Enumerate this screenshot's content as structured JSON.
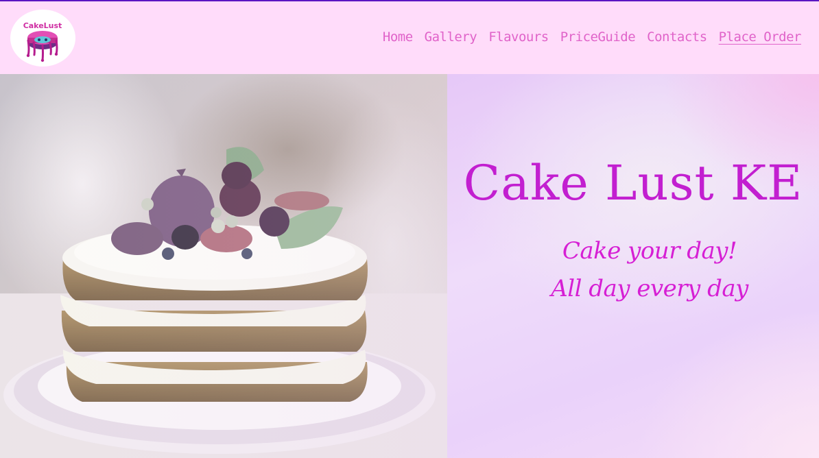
{
  "header": {
    "logo_text": "CakeLust",
    "nav": [
      {
        "label": "Home"
      },
      {
        "label": "Gallery"
      },
      {
        "label": "Flavours"
      },
      {
        "label": "PriceGuide"
      },
      {
        "label": "Contacts"
      },
      {
        "label": "Place Order",
        "active": true
      }
    ]
  },
  "hero": {
    "title": "Cake Lust KE",
    "tagline_line1": "Cake your day!",
    "tagline_line2": "All day every day"
  },
  "colors": {
    "header_bg": "#ffdcfa",
    "header_border": "#5a16c2",
    "nav_text": "#e063c9",
    "title": "#c21fd0",
    "tagline": "#d61fd4"
  },
  "icons": {
    "logo": "dripping-cake-logo",
    "hero": "layered-naked-cake-photo"
  }
}
